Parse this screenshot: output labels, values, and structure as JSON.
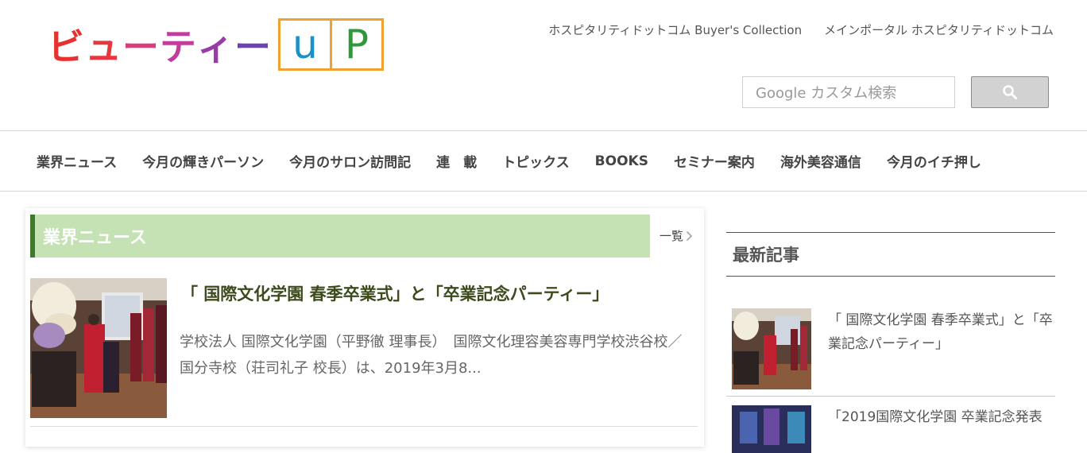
{
  "logo": {
    "chars": [
      {
        "text": "ビ",
        "color": "#e8312f"
      },
      {
        "text": "ュ",
        "color": "#e8363f"
      },
      {
        "text": "ー",
        "color": "#e03a7a"
      },
      {
        "text": "テ",
        "color": "#c23c9c"
      },
      {
        "text": "ィ",
        "color": "#9a3ca8"
      },
      {
        "text": "ー",
        "color": "#6c42b4"
      }
    ],
    "box_letters": [
      {
        "text": "u",
        "color": "#1a8fc8"
      },
      {
        "text": "P",
        "color": "#2a9a3a"
      }
    ],
    "box_color": "#f0a030"
  },
  "toplinks": [
    "ホスピタリティドットコム Buyer's Collection",
    "メインポータル ホスピタリティドットコム"
  ],
  "search": {
    "placeholder": "Google カスタム検索",
    "button_icon": "search-icon"
  },
  "nav": [
    "業界ニュース",
    "今月の輝きパーソン",
    "今月のサロン訪問記",
    "連　載",
    "トピックス",
    "BOOKS",
    "セミナー案内",
    "海外美容通信",
    "今月のイチ押し"
  ],
  "news": {
    "section_title": "業界ニュース",
    "more_label": "一覧",
    "accent_color": "#c4e2b4",
    "article": {
      "title": "「 国際文化学園 春季卒業式」と「卒業記念パーティー」",
      "excerpt": "学校法人 国際文化学園（平野徹 理事長）　国際文化理容美容専門学校渋谷校／国分寺校（荘司礼子 校長）は、2019年3月8..."
    }
  },
  "sidebar": {
    "title": "最新記事",
    "items": [
      {
        "title": "「 国際文化学園 春季卒業式」と「卒業記念パーティー」"
      },
      {
        "title": "「2019国際文化学園 卒業記念発表"
      }
    ]
  }
}
